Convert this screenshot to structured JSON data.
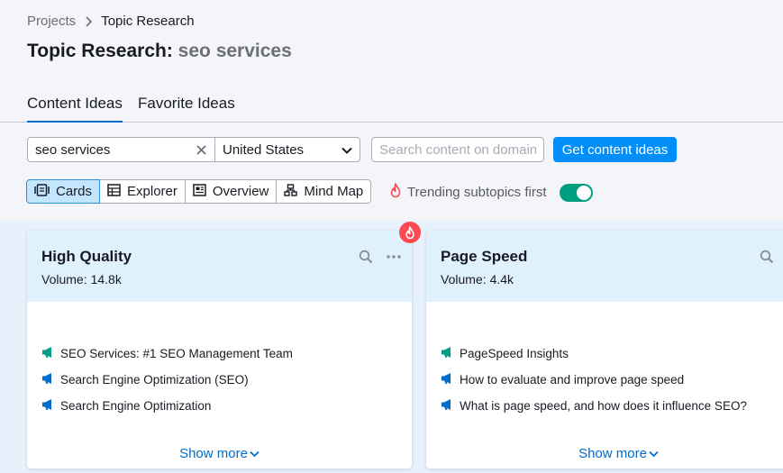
{
  "breadcrumb": {
    "items": [
      "Projects",
      "Topic Research"
    ]
  },
  "title": {
    "prefix": "Topic Research:",
    "keyword": "seo services"
  },
  "tabs": [
    {
      "label": "Content Ideas",
      "active": true
    },
    {
      "label": "Favorite Ideas",
      "active": false
    }
  ],
  "search": {
    "value": "seo services",
    "country": "United States",
    "domain_placeholder": "Search content on domain",
    "submit_label": "Get content ideas"
  },
  "views": [
    {
      "label": "Cards",
      "icon": "cards-icon",
      "active": true
    },
    {
      "label": "Explorer",
      "icon": "table-icon",
      "active": false
    },
    {
      "label": "Overview",
      "icon": "overview-icon",
      "active": false
    },
    {
      "label": "Mind Map",
      "icon": "mind-map-icon",
      "active": false
    }
  ],
  "trending": {
    "label": "Trending subtopics first",
    "enabled": true
  },
  "cards": [
    {
      "title": "High Quality",
      "volume_label": "Volume:",
      "volume": "14.8k",
      "trending": true,
      "ideas": [
        {
          "text": "SEO Services: #1 SEO Management Team",
          "icon_color": "#009f81"
        },
        {
          "text": "Search Engine Optimization (SEO)",
          "icon_color": "#006dca"
        },
        {
          "text": "Search Engine Optimization",
          "icon_color": "#006dca"
        }
      ],
      "show_more": "Show more"
    },
    {
      "title": "Page Speed",
      "volume_label": "Volume:",
      "volume": "4.4k",
      "trending": false,
      "ideas": [
        {
          "text": "PageSpeed Insights",
          "icon_color": "#009f81"
        },
        {
          "text": "How to evaluate and improve page speed",
          "icon_color": "#006dca"
        },
        {
          "text": "What is page speed, and how does it influence SEO?",
          "icon_color": "#006dca"
        }
      ],
      "show_more": "Show more"
    }
  ],
  "colors": {
    "accent": "#008ff8",
    "link": "#006dca",
    "toggle_on": "#009f81",
    "fire": "#ff4953"
  }
}
